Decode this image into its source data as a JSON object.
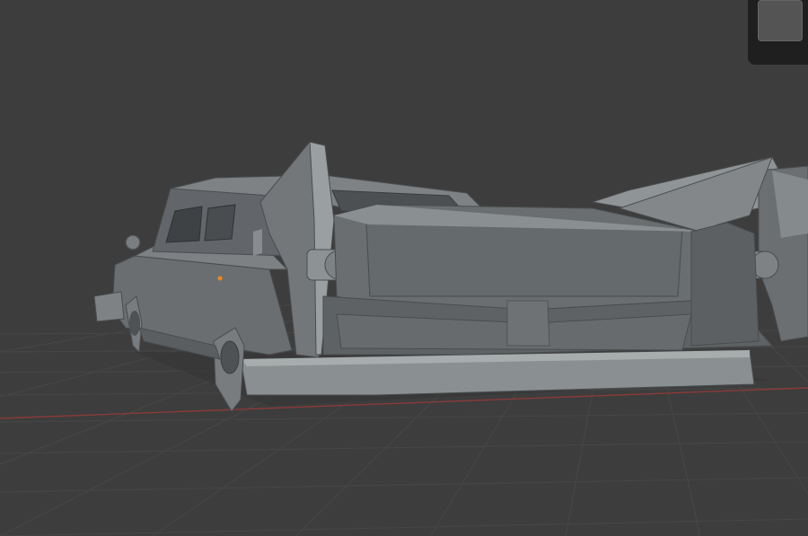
{
  "viewport": {
    "background_color": "#3d3d3d",
    "grid_color": "#474747",
    "x_axis_color": "#8a3a3a",
    "origin_marker_color": "#e88a1a"
  },
  "model": {
    "icon": "car-mesh-icon",
    "body_color": "#7a7e80",
    "shadow_color": "#4f5254",
    "highlight_color": "#a7acad"
  },
  "overlay": {
    "icon": "viewport-gizmo-icon",
    "panel_color": "#1f1f1f",
    "tile_color": "#545454"
  }
}
